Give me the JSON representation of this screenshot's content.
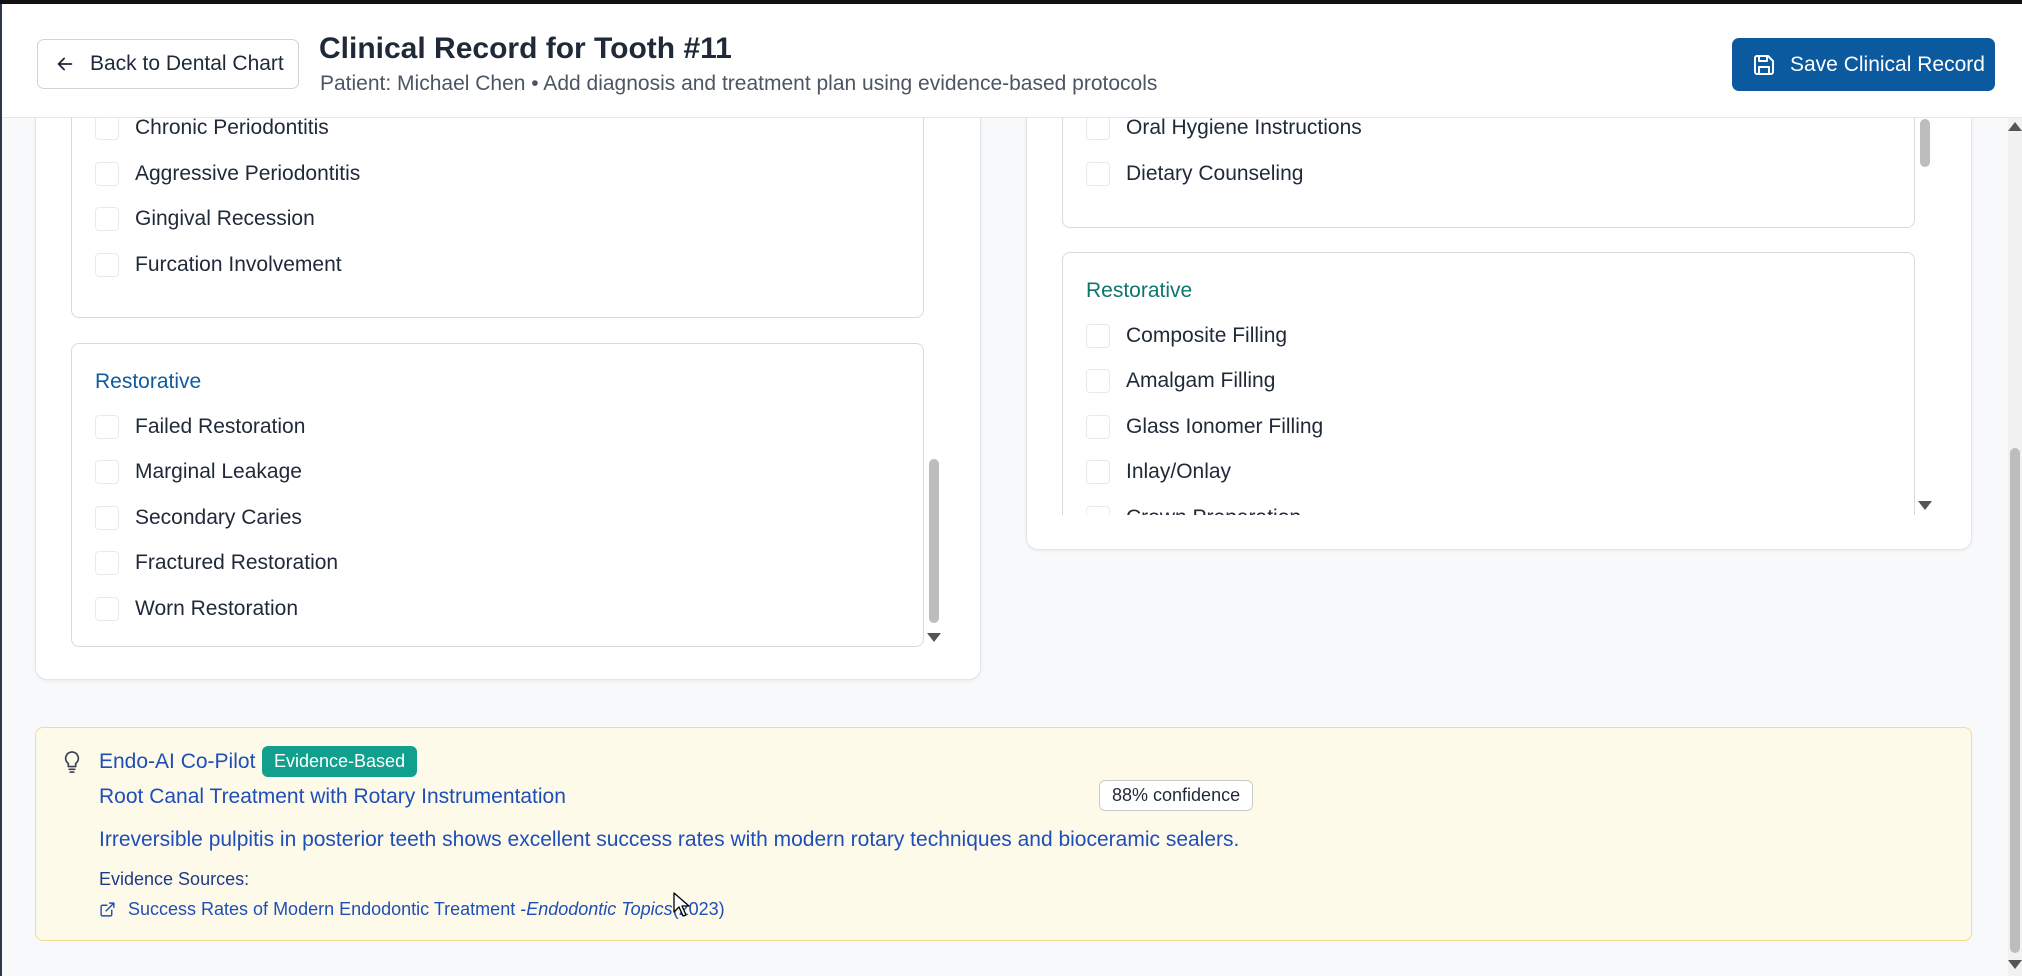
{
  "header": {
    "back_label": "Back to Dental Chart",
    "title": "Clinical Record for Tooth #11",
    "subtitle": "Patient: Michael Chen • Add diagnosis and treatment plan using evidence-based protocols",
    "save_label": "Save Clinical Record"
  },
  "diagnosis": {
    "periodontal_items": [
      "Chronic Periodontitis",
      "Aggressive Periodontitis",
      "Gingival Recession",
      "Furcation Involvement"
    ],
    "restorative_title": "Restorative",
    "restorative_items": [
      "Failed Restoration",
      "Marginal Leakage",
      "Secondary Caries",
      "Fractured Restoration",
      "Worn Restoration"
    ]
  },
  "treatment": {
    "preventive_items": [
      "Oral Hygiene Instructions",
      "Dietary Counseling"
    ],
    "restorative_title": "Restorative",
    "restorative_items": [
      "Composite Filling",
      "Amalgam Filling",
      "Glass Ionomer Filling",
      "Inlay/Onlay",
      "Crown Preparation"
    ]
  },
  "copilot": {
    "name": "Endo-AI Co-Pilot",
    "badge": "Evidence-Based",
    "recommendation": "Root Canal Treatment with Rotary Instrumentation",
    "confidence": "88% confidence",
    "description": "Irreversible pulpitis in posterior teeth shows excellent success rates with modern rotary techniques and bioceramic sealers.",
    "evidence_label": "Evidence Sources:",
    "source_title": "Success Rates of Modern Endodontic Treatment - ",
    "source_journal": "Endodontic Topics",
    "source_year": " (2023)"
  },
  "colors": {
    "primary": "#0b5aa0",
    "badge": "#12a08e",
    "ai_background": "#fefaea",
    "ai_text": "#1e4fb8"
  }
}
